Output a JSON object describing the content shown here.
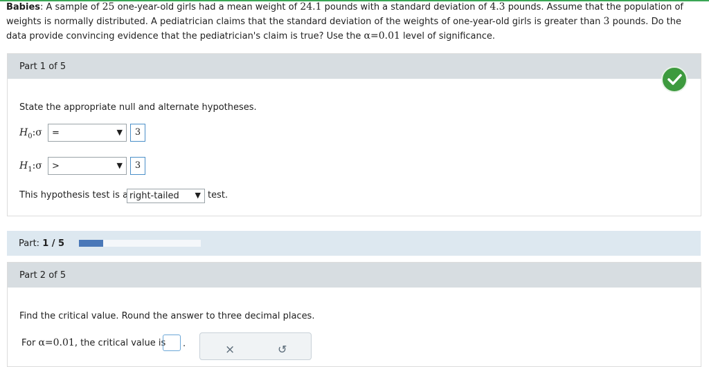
{
  "problem": {
    "bold_lead": "Babies",
    "t1": ": A sample of ",
    "n": "25",
    "t2": " one-year-old girls had a mean weight of ",
    "mean": "24.1",
    "t3": " pounds with a standard deviation of ",
    "sd": "4.3",
    "t4": " pounds. Assume that the population of weights is normally distributed. A pediatrician claims that the standard deviation of the weights of one-year-old girls is greater than ",
    "claim": "3",
    "t5": " pounds. Do the data provide convincing evidence that the pediatrician's claim is true? Use the ",
    "alpha_sym": "α=0.01",
    "t6": " level of significance."
  },
  "part1": {
    "title": "Part 1 of 5",
    "instruction": "State the appropriate null and alternate hypotheses.",
    "h0": {
      "label": "H",
      "sub": "0",
      "param": ":σ",
      "relation": "=",
      "value": "3"
    },
    "h1": {
      "label": "H",
      "sub": "1",
      "param": ":σ",
      "relation": ">",
      "value": "3"
    },
    "test_prefix": "This hypothesis test is a",
    "test_type": "right-tailed",
    "test_suffix": "test.",
    "arrow": "▼",
    "status_icon": "checkmark-icon",
    "status_color": "#3d9a3e"
  },
  "progress": {
    "prefix": "Part: ",
    "current": "1 / 5",
    "fraction": 0.2
  },
  "part2": {
    "title": "Part 2 of 5",
    "instruction": "Find the critical value. Round the answer to three decimal places.",
    "answer_prefix": "For ",
    "alpha": "α=0.01",
    "answer_mid": ", the critical value is",
    "answer_suffix": ".",
    "answer_value": "",
    "tool_clear": "×",
    "tool_undo": "↺"
  }
}
